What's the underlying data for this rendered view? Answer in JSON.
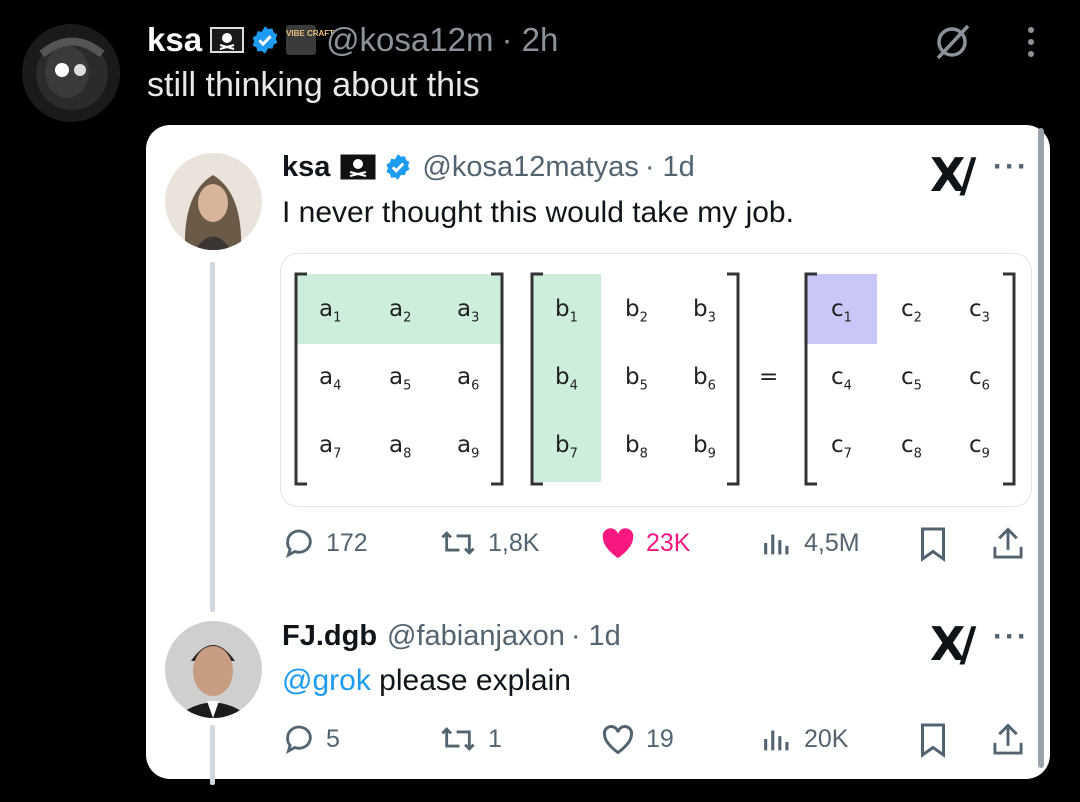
{
  "outer_post": {
    "name": "ksa",
    "badge_text": "VIBE CRAFT",
    "handle": "@kosa12m",
    "time": "· 2h",
    "text": "still thinking about this"
  },
  "quoted_post": {
    "name": "ksa",
    "handle": "@kosa12matyas",
    "time": "· 1d",
    "text": "I never thought this would take my job.",
    "more": "···",
    "brand": "X/",
    "matrix": {
      "a": [
        [
          "a",
          "1"
        ],
        [
          "a",
          "2"
        ],
        [
          "a",
          "3"
        ],
        [
          "a",
          "4"
        ],
        [
          "a",
          "5"
        ],
        [
          "a",
          "6"
        ],
        [
          "a",
          "7"
        ],
        [
          "a",
          "8"
        ],
        [
          "a",
          "9"
        ]
      ],
      "b": [
        [
          "b",
          "1"
        ],
        [
          "b",
          "2"
        ],
        [
          "b",
          "3"
        ],
        [
          "b",
          "4"
        ],
        [
          "b",
          "5"
        ],
        [
          "b",
          "6"
        ],
        [
          "b",
          "7"
        ],
        [
          "b",
          "8"
        ],
        [
          "b",
          "9"
        ]
      ],
      "c": [
        [
          "c",
          "1"
        ],
        [
          "c",
          "2"
        ],
        [
          "c",
          "3"
        ],
        [
          "c",
          "4"
        ],
        [
          "c",
          "5"
        ],
        [
          "c",
          "6"
        ],
        [
          "c",
          "7"
        ],
        [
          "c",
          "8"
        ],
        [
          "c",
          "9"
        ]
      ],
      "equals": "="
    },
    "stats": {
      "replies": "172",
      "reposts": "1,8K",
      "likes": "23K",
      "views": "4,5M"
    },
    "like_color": "#f91880"
  },
  "reply_post": {
    "name": "FJ.dgb",
    "handle": "@fabianjaxon",
    "time": "· 1d",
    "mention": "@grok",
    "text": " please explain",
    "more": "···",
    "brand": "X/",
    "stats": {
      "replies": "5",
      "reposts": "1",
      "likes": "19",
      "views": "20K"
    }
  },
  "colors": {
    "verified": "#1d9bf0",
    "link": "#1d9bf0",
    "highlight_green": "#cdeedb",
    "highlight_purple": "#c9c7f7"
  }
}
